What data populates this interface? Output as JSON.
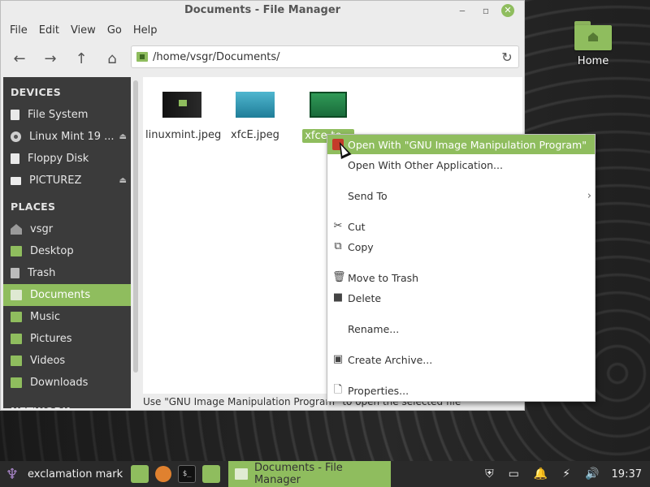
{
  "window": {
    "title": "Documents - File Manager",
    "min_glyph": "‒",
    "max_glyph": "▫",
    "close_glyph": "✕"
  },
  "menubar": [
    "File",
    "Edit",
    "View",
    "Go",
    "Help"
  ],
  "toolbar": {
    "back_icon": "←",
    "forward_icon": "→",
    "up_icon": "↑",
    "home_icon": "⌂",
    "path": "/home/vsgr/Documents/",
    "reload_icon": "↻"
  },
  "sidebar": {
    "devices_heading": "DEVICES",
    "devices": [
      {
        "label": "File System",
        "icon": "drive-icon"
      },
      {
        "label": "Linux Mint 19 ...",
        "icon": "disc-icon",
        "eject": "⏏"
      },
      {
        "label": "Floppy Disk",
        "icon": "floppy-icon"
      },
      {
        "label": "PICTUREZ",
        "icon": "drive-icon",
        "eject": "⏏"
      }
    ],
    "places_heading": "PLACES",
    "places": [
      {
        "label": "vsgr",
        "icon": "home-icon"
      },
      {
        "label": "Desktop",
        "icon": "folder-icon"
      },
      {
        "label": "Trash",
        "icon": "trash-icon"
      },
      {
        "label": "Documents",
        "icon": "folder-icon",
        "selected": true
      },
      {
        "label": "Music",
        "icon": "folder-icon"
      },
      {
        "label": "Pictures",
        "icon": "folder-icon"
      },
      {
        "label": "Videos",
        "icon": "folder-icon"
      },
      {
        "label": "Downloads",
        "icon": "folder-icon"
      }
    ],
    "network_heading": "NETWORK"
  },
  "files": [
    {
      "name": "linuxmint.jpeg"
    },
    {
      "name": "xfcE.jpeg"
    },
    {
      "name": "xfce-te...",
      "selected": true
    }
  ],
  "statusbar": "Use \"GNU Image Manipulation Program\" to open the selected file",
  "context_menu": {
    "open_with_gimp": "Open With \"GNU Image Manipulation Program\"",
    "open_with_other": "Open With Other Application...",
    "send_to": "Send To",
    "cut": "Cut",
    "copy": "Copy",
    "move_to_trash": "Move to Trash",
    "delete": "Delete",
    "rename": "Rename...",
    "create_archive": "Create Archive...",
    "properties": "Properties...",
    "submenu_arrow": "›"
  },
  "desktop": {
    "home_label": "Home"
  },
  "taskbar": {
    "app_menu_label": "exclamation mark",
    "terminal_glyph": "$_",
    "active_window": "Documents - File Manager",
    "clock": "19:37"
  },
  "colors": {
    "accent": "#8fbd5e",
    "sidebar_bg": "#3b3b3b",
    "taskbar_bg": "#2a2a2a"
  }
}
